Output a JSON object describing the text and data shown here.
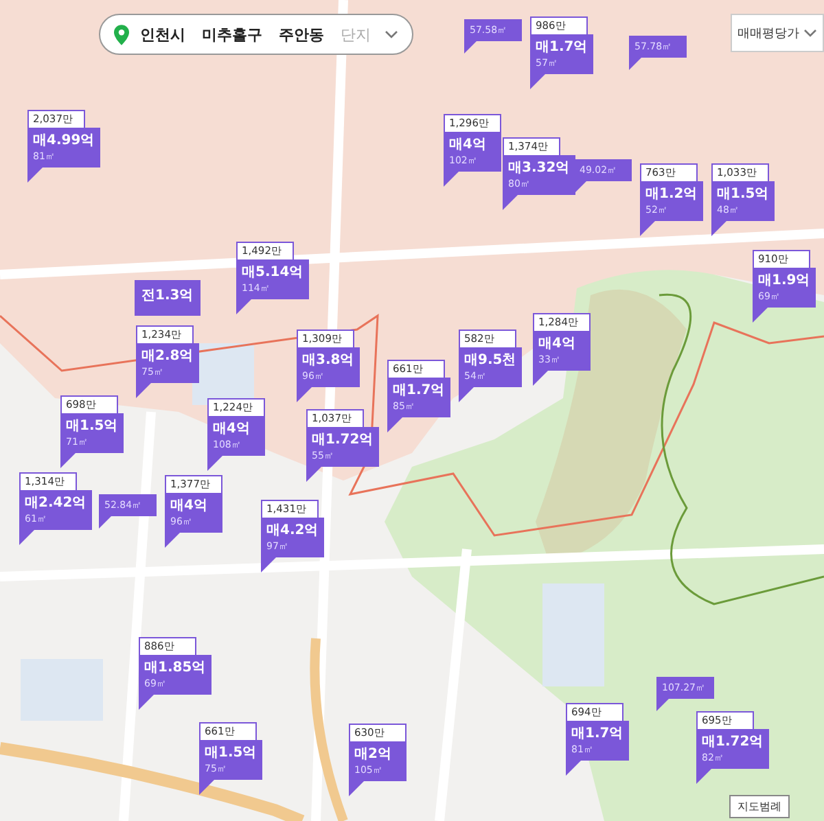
{
  "breadcrumb": {
    "items": [
      {
        "label": "인천시",
        "selected": true
      },
      {
        "label": "미추홀구",
        "selected": true
      },
      {
        "label": "주안동",
        "selected": true
      },
      {
        "label": "단지",
        "selected": false
      }
    ]
  },
  "price_type_dropdown": {
    "value": "매매평당가"
  },
  "markers": [
    {
      "kind": "area-tag",
      "area": "57.58㎡"
    },
    {
      "kind": "area-tag",
      "area": "57.78㎡"
    },
    {
      "kind": "listing",
      "unit_price": "986만",
      "price": "매1.7억",
      "area": "57㎡"
    },
    {
      "kind": "listing",
      "unit_price": "2,037만",
      "price": "매4.99억",
      "area": "81㎡"
    },
    {
      "kind": "listing",
      "unit_price": "1,296만",
      "price": "매4억",
      "area": "102㎡"
    },
    {
      "kind": "listing",
      "unit_price": "1,374만",
      "price": "매3.32억",
      "area": "80㎡"
    },
    {
      "kind": "area-tag",
      "area": "49.02㎡"
    },
    {
      "kind": "listing",
      "unit_price": "763만",
      "price": "매1.2억",
      "area": "52㎡"
    },
    {
      "kind": "listing",
      "unit_price": "1,033만",
      "price": "매1.5억",
      "area": "48㎡"
    },
    {
      "kind": "deal-only",
      "price": "전1.3억"
    },
    {
      "kind": "listing",
      "unit_price": "1,492만",
      "price": "매5.14억",
      "area": "114㎡"
    },
    {
      "kind": "listing",
      "unit_price": "910만",
      "price": "매1.9억",
      "area": "69㎡"
    },
    {
      "kind": "listing",
      "unit_price": "1,234만",
      "price": "매2.8억",
      "area": "75㎡"
    },
    {
      "kind": "listing",
      "unit_price": "1,309만",
      "price": "매3.8억",
      "area": "96㎡"
    },
    {
      "kind": "listing",
      "unit_price": "1,284만",
      "price": "매4억",
      "area": "33㎡"
    },
    {
      "kind": "listing",
      "unit_price": "582만",
      "price": "매9.5천",
      "area": "54㎡"
    },
    {
      "kind": "listing",
      "unit_price": "661만",
      "price": "매1.7억",
      "area": "85㎡"
    },
    {
      "kind": "listing",
      "unit_price": "698만",
      "price": "매1.5억",
      "area": "71㎡"
    },
    {
      "kind": "listing",
      "unit_price": "1,224만",
      "price": "매4억",
      "area": "108㎡"
    },
    {
      "kind": "listing",
      "unit_price": "1,037만",
      "price": "매1.72억",
      "area": "55㎡"
    },
    {
      "kind": "area-tag",
      "area": "52.84㎡"
    },
    {
      "kind": "listing",
      "unit_price": "1,314만",
      "price": "매2.42억",
      "area": "61㎡"
    },
    {
      "kind": "listing",
      "unit_price": "1,377만",
      "price": "매4억",
      "area": "96㎡"
    },
    {
      "kind": "listing",
      "unit_price": "1,431만",
      "price": "매4.2억",
      "area": "97㎡"
    },
    {
      "kind": "listing",
      "unit_price": "886만",
      "price": "매1.85억",
      "area": "69㎡"
    },
    {
      "kind": "listing",
      "unit_price": "661만",
      "price": "매1.5억",
      "area": "75㎡"
    },
    {
      "kind": "listing",
      "unit_price": "630만",
      "price": "매2억",
      "area": "105㎡"
    },
    {
      "kind": "area-tag",
      "area": "107.27㎡"
    },
    {
      "kind": "listing",
      "unit_price": "694만",
      "price": "매1.7억",
      "area": "81㎡"
    },
    {
      "kind": "listing",
      "unit_price": "695만",
      "price": "매1.72억",
      "area": "82㎡"
    }
  ],
  "legend_button": {
    "label": "지도범례"
  }
}
